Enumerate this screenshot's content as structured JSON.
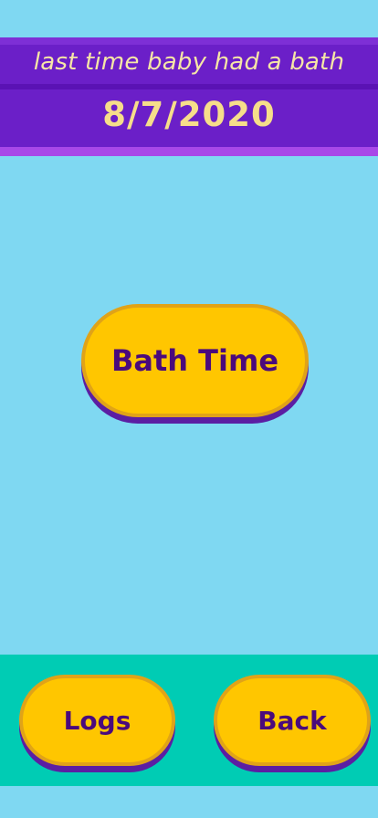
{
  "header": {
    "subtitle": "last time baby had a bath",
    "last_bath_date": "8/7/2020"
  },
  "main": {
    "bath_button_label": "Bath Time"
  },
  "footer": {
    "logs_label": "Logs",
    "back_label": "Back"
  },
  "colors": {
    "background": "#7fd8f2",
    "header": "#6b1fc8",
    "header_accent": "#a848e8",
    "button_fill": "#ffc600",
    "button_text": "#4a0a7c",
    "footer": "#00ccb4"
  }
}
